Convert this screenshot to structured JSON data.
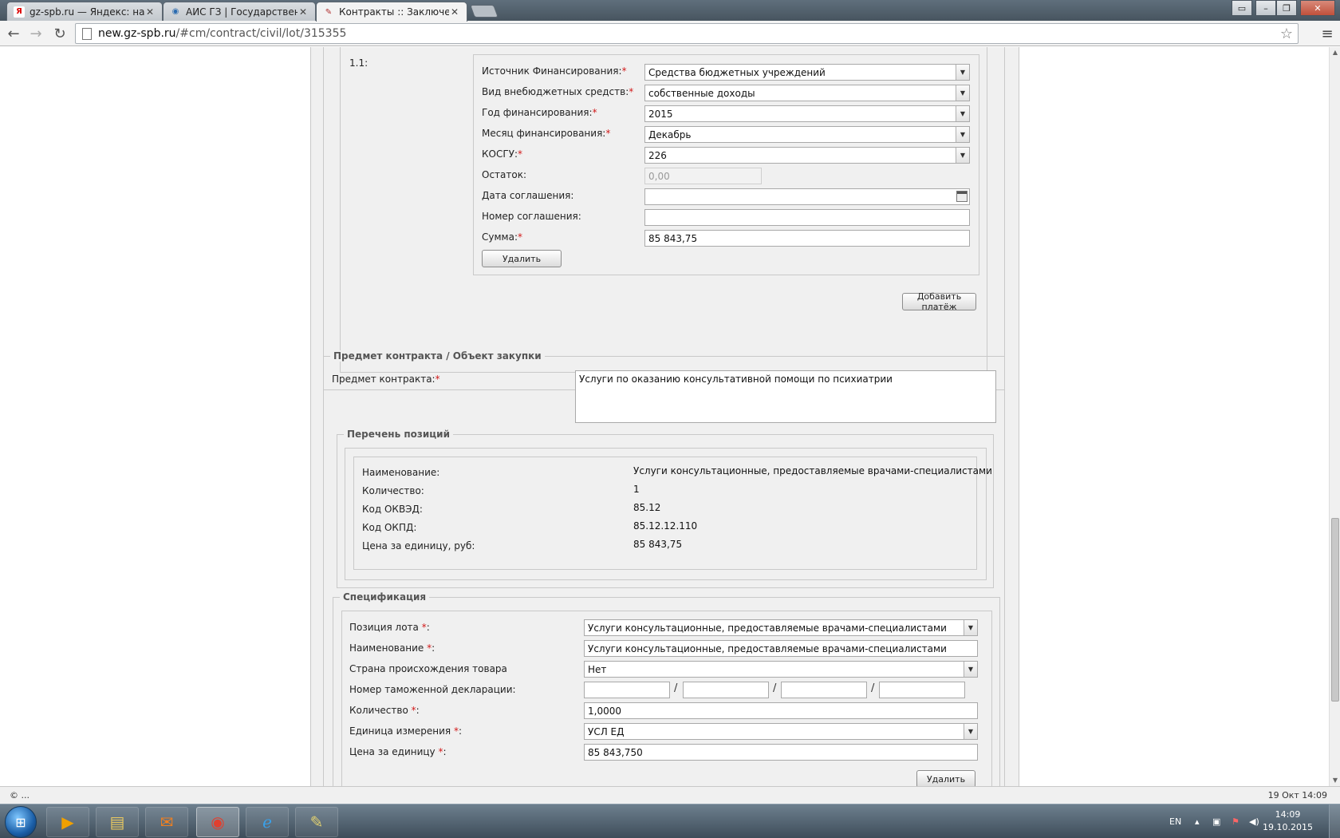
{
  "browser": {
    "tabs": [
      {
        "title": "gz-spb.ru — Яндекс: наш",
        "favicon": "Я"
      },
      {
        "title": "АИС ГЗ | Государственны",
        "favicon": "◉"
      },
      {
        "title": "Контракты :: Заключение",
        "favicon": "✎"
      }
    ],
    "url_host": "new.gz-spb.ru",
    "url_rest": "/#cm/contract/civil/lot/315355"
  },
  "payment": {
    "index": "1.1:",
    "fields": [
      {
        "label": "Источник Финансирования:",
        "value": "Средства бюджетных учреждений"
      },
      {
        "label": "Вид внебюджетных средств:",
        "value": "собственные доходы"
      },
      {
        "label": "Год финансирования:",
        "value": "2015"
      },
      {
        "label": "Месяц финансирования:",
        "value": "Декабрь"
      },
      {
        "label": "КОСГУ:",
        "value": "226"
      },
      {
        "label": "Остаток:",
        "value": "0,00"
      },
      {
        "label": "Дата соглашения:",
        "value": ""
      },
      {
        "label": "Номер соглашения:",
        "value": ""
      },
      {
        "label": "Сумма:",
        "value": "85 843,75"
      }
    ],
    "required_mark": "*",
    "delete_label": "Удалить",
    "add_payment_label": "Добавить платёж"
  },
  "subject": {
    "legend": "Предмет контракта / Объект закупки",
    "label": "Предмет контракта:",
    "value": "Услуги по оказанию консультативной помощи по психиатрии"
  },
  "positions": {
    "legend": "Перечень позиций",
    "rows": [
      {
        "label": "Наименование:",
        "value": "Услуги консультационные, предоставляемые врачами-специалистами"
      },
      {
        "label": "Количество:",
        "value": "1"
      },
      {
        "label": "Код ОКВЭД:",
        "value": "85.12"
      },
      {
        "label": "Код ОКПД:",
        "value": "85.12.12.110"
      },
      {
        "label": "Цена за единицу, руб:",
        "value": "85 843,75"
      }
    ]
  },
  "spec": {
    "legend": "Спецификация",
    "lot_position": {
      "label": "Позиция лота ",
      "value": "Услуги консультационные, предоставляемые врачами-специалистами"
    },
    "name": {
      "label": "Наименование ",
      "value": "Услуги консультационные, предоставляемые врачами-специалистами"
    },
    "country": {
      "label": "Страна происхождения товара",
      "value": "Нет"
    },
    "customs": {
      "label": "Номер таможенной декларации:",
      "sep": "/"
    },
    "quantity": {
      "label": "Количество ",
      "value": "1,0000"
    },
    "unit": {
      "label": "Единица измерения ",
      "value": "УСЛ ЕД"
    },
    "price": {
      "label": "Цена за единицу ",
      "value": "85 843,750"
    },
    "colon": ":",
    "delete_label": "Удалить"
  },
  "statusbar": {
    "left": "© ...",
    "right": "19 Окт 14:09"
  },
  "taskbar": {
    "lang": "EN",
    "time": "14:09",
    "date": "19.10.2015"
  }
}
